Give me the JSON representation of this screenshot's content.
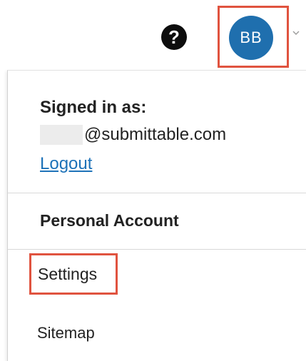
{
  "header": {
    "help_icon_glyph": "?",
    "avatar_initials": "BB",
    "avatar_color": "#1f6fae"
  },
  "dropdown": {
    "signed_in_label": "Signed in as:",
    "email_domain": "@submittable.com",
    "logout_label": "Logout",
    "personal_account_label": "Personal Account",
    "settings_label": "Settings",
    "sitemap_label": "Sitemap"
  },
  "colors": {
    "highlight": "#e0533f",
    "link": "#1d72b8"
  },
  "icons": {
    "help": "question-circle-icon",
    "menu_toggle": "chevron-down-icon"
  }
}
